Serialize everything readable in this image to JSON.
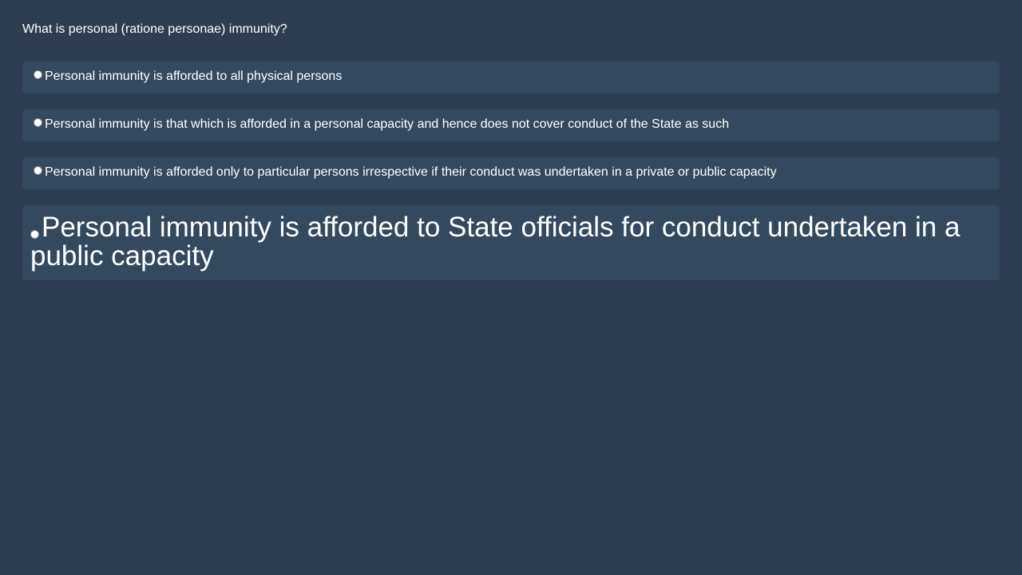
{
  "question": {
    "text": "What is personal (ratione personae) immunity?"
  },
  "options": [
    {
      "label": "Personal immunity is afforded to all physical persons",
      "selected": false
    },
    {
      "label": "Personal immunity is that which is afforded in a personal capacity and hence does not cover conduct of the State as such",
      "selected": false
    },
    {
      "label": "Personal immunity is afforded only to particular persons irrespective if their conduct was undertaken in a private or public capacity",
      "selected": false
    },
    {
      "label": "Personal immunity is afforded to State officials for conduct undertaken in a public capacity",
      "selected": false
    }
  ],
  "colors": {
    "background": "#2e3d4f",
    "option_background": "#34495e",
    "text": "#ffffff"
  }
}
